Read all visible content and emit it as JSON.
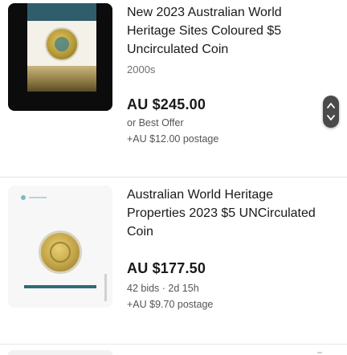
{
  "listings": [
    {
      "title": "New 2023 Australian World Heritage Sites Coloured $5 Uncirculated Coin",
      "subtitle": "2000s",
      "price": "AU $245.00",
      "meta_line_1": "or Best Offer",
      "meta_line_2": "+AU $12.00 postage",
      "image_icon": "coin-card-image"
    },
    {
      "title": "Australian World Heritage Properties 2023 $5 UNCirculated Coin",
      "price": "AU $177.50",
      "meta_line_1": "42 bids · 2d 15h",
      "meta_line_2": "+AU $9.70 postage",
      "image_icon": "coin-card-image"
    }
  ],
  "scroll_handle_icon": "fast-scroll-handle-icon",
  "colors": {
    "title_text": "#191919",
    "secondary_text": "#555555",
    "divider": "#e6e6e6",
    "scroll_handle": "#4a4a4a"
  }
}
